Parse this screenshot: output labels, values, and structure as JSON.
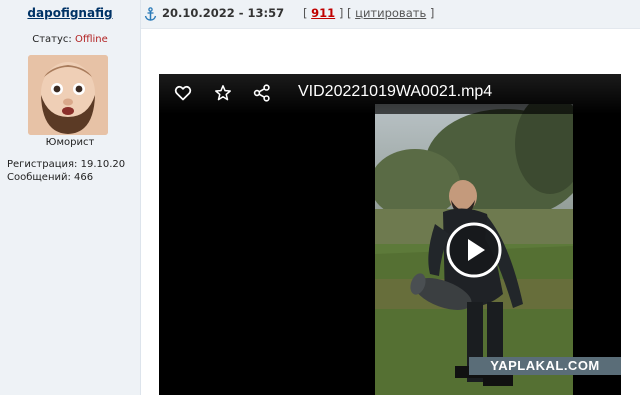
{
  "user": {
    "username": "dapofignafig",
    "status_label": "Статус:",
    "status_value": "Offline",
    "rank": "Юморист",
    "registration": "Регистрация: 19.10.20",
    "messages": "Сообщений: 466"
  },
  "post": {
    "date": "20.10.2022 - 13:57",
    "bracket_open": "[",
    "count": "911",
    "bracket_mid": "] [",
    "quote_label": "цитировать",
    "bracket_close": "]"
  },
  "video": {
    "filename": "VID20221019WA0021.mp4",
    "icons": [
      "heart-icon",
      "star-icon",
      "share-icon",
      "play-icon"
    ]
  },
  "watermark": "YAPLAKAL.COM",
  "colors": {
    "username": "#003366",
    "offline": "#b22222",
    "count": "#c00000",
    "watermark_bg": "#5a6d78"
  }
}
